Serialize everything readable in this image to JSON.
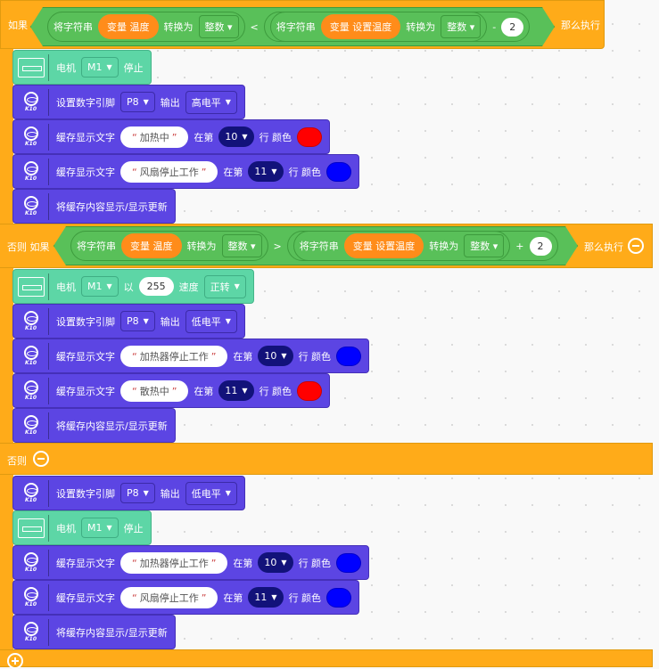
{
  "colors": {
    "control": "#ffab19",
    "operator": "#59c059",
    "variable": "#ff8c1a",
    "motor": "#5dd6a6",
    "k10": "#5c45e3",
    "red": "#ff0000",
    "blue": "#0000ff"
  },
  "icon_text": "K10",
  "if_label": "如果",
  "elseif_label": "否则 如果",
  "else_label": "否则",
  "then_label": "那么执行",
  "conditions": [
    {
      "str": "将字符串",
      "var": "变量",
      "var_name": "温度",
      "convert": "转换为",
      "type": "整数",
      "op": "<",
      "str2": "将字符串",
      "var2": "变量",
      "var_name2": "设置温度",
      "convert2": "转换为",
      "type2": "整数",
      "arith": "-",
      "num": "2"
    },
    {
      "str": "将字符串",
      "var": "变量",
      "var_name": "温度",
      "convert": "转换为",
      "type": "整数",
      "op": ">",
      "str2": "将字符串",
      "var2": "变量",
      "var_name2": "设置温度",
      "convert2": "转换为",
      "type2": "整数",
      "arith": "+",
      "num": "2"
    }
  ],
  "blocks": [
    {
      "kind": "motor_stop",
      "label": "电机",
      "motor": "M1",
      "action": "停止"
    },
    {
      "kind": "set_pin",
      "label": "设置数字引脚",
      "pin": "P8",
      "out": "输出",
      "level": "高电平"
    },
    {
      "kind": "cache",
      "label": "缓存显示文字",
      "text": "加热中",
      "at": "在第",
      "line": "10",
      "row": "行 颜色",
      "color": "#ff0000"
    },
    {
      "kind": "cache",
      "label": "缓存显示文字",
      "text": "风扇停止工作",
      "at": "在第",
      "line": "11",
      "row": "行 颜色",
      "color": "#0000ff"
    },
    {
      "kind": "refresh",
      "label": "将缓存内容显示/显示更新"
    },
    {
      "kind": "motor_run",
      "label": "电机",
      "motor": "M1",
      "with": "以",
      "speed": "255",
      "speed_label": "速度",
      "dir": "正转"
    },
    {
      "kind": "set_pin",
      "label": "设置数字引脚",
      "pin": "P8",
      "out": "输出",
      "level": "低电平"
    },
    {
      "kind": "cache",
      "label": "缓存显示文字",
      "text": "加热器停止工作",
      "at": "在第",
      "line": "10",
      "row": "行 颜色",
      "color": "#0000ff"
    },
    {
      "kind": "cache",
      "label": "缓存显示文字",
      "text": "散热中",
      "at": "在第",
      "line": "11",
      "row": "行 颜色",
      "color": "#ff0000"
    },
    {
      "kind": "refresh",
      "label": "将缓存内容显示/显示更新"
    },
    {
      "kind": "set_pin",
      "label": "设置数字引脚",
      "pin": "P8",
      "out": "输出",
      "level": "低电平"
    },
    {
      "kind": "motor_stop",
      "label": "电机",
      "motor": "M1",
      "action": "停止"
    },
    {
      "kind": "cache",
      "label": "缓存显示文字",
      "text": "加热器停止工作",
      "at": "在第",
      "line": "10",
      "row": "行 颜色",
      "color": "#0000ff"
    },
    {
      "kind": "cache",
      "label": "缓存显示文字",
      "text": "风扇停止工作",
      "at": "在第",
      "line": "11",
      "row": "行 颜色",
      "color": "#0000ff"
    },
    {
      "kind": "refresh",
      "label": "将缓存内容显示/显示更新"
    }
  ]
}
